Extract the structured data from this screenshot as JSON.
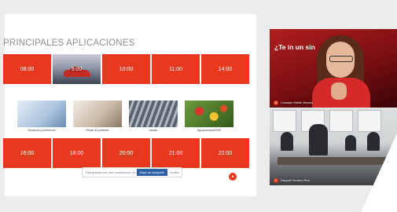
{
  "slide": {
    "title": "PRINCIPALES APLICACIONES",
    "top_row": [
      "08:00",
      "9:00",
      "10:00",
      "11:00",
      "14:00"
    ],
    "bottom_row": [
      "16:00",
      "18:00",
      "20:00",
      "21:00",
      "22:00"
    ],
    "apps": [
      {
        "label": "Sensores y periféricos"
      },
      {
        "label": "Fibras de poliéster"
      },
      {
        "label": "Asfalto"
      },
      {
        "label": "Agropecuaria/PMS"
      }
    ]
  },
  "meeting_bar": {
    "text": "Está grabado por este complemento se cambios",
    "button": "Dejar de compartir",
    "close": "Ocultar"
  },
  "record_icon": "●",
  "videos": [
    {
      "initial": "M",
      "name": "Colorado Martín Moreno",
      "slogan": "¿Te in un sin"
    },
    {
      "initial": "S",
      "name": "Daspuel Serrano Rico"
    }
  ],
  "colors": {
    "accent": "#e8391e",
    "button_blue": "#2e5fa8"
  }
}
